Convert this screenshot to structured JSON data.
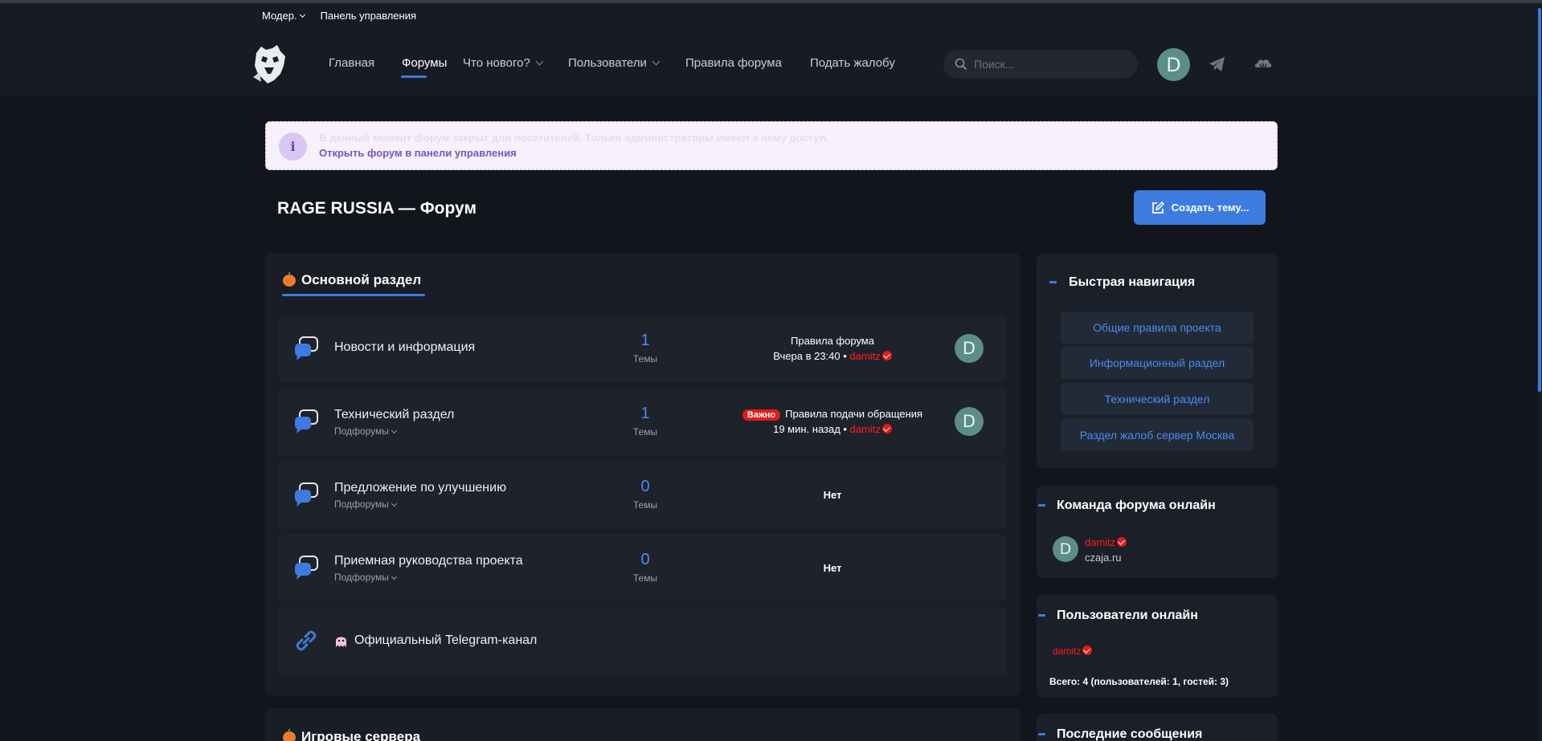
{
  "util_bar": {
    "moderation": "Модер.",
    "admin_panel": "Панель управления"
  },
  "nav": {
    "items": [
      {
        "label": "Главная"
      },
      {
        "label": "Форумы"
      },
      {
        "label": "Что нового?"
      },
      {
        "label": "Пользователи"
      },
      {
        "label": "Правила форума"
      },
      {
        "label": "Подать жалобу"
      }
    ],
    "active": "Форумы"
  },
  "search": {
    "placeholder": "Поиск..."
  },
  "header": {
    "avatar_letter": "D"
  },
  "notice": {
    "text": "В данный момент форум закрыт для посетителей. Только администраторы имеют к нему доступ.",
    "link": "Открыть форум в панели управления"
  },
  "page": {
    "title": "RAGE RUSSIA — Форум",
    "create_button": "Создать тему..."
  },
  "main_section": {
    "title": "Основной раздел",
    "forums": [
      {
        "title": "Новости и информация",
        "count": "1",
        "count_label": "Темы",
        "last_title": "Правила форума",
        "last_time": "Вчера в 23:40",
        "last_user": "damitz",
        "avatar": "D"
      },
      {
        "title": "Технический раздел",
        "subforums": "Подфорумы",
        "count": "1",
        "count_label": "Темы",
        "badge": "Важно",
        "last_title": "Правила подачи обращения",
        "last_time": "19 мин. назад",
        "last_user": "damitz",
        "avatar": "D"
      },
      {
        "title": "Предложение по улучшению",
        "subforums": "Подфорумы",
        "count": "0",
        "count_label": "Темы",
        "last_none": "Нет"
      },
      {
        "title": "Приемная руководства проекта",
        "subforums": "Подфорумы",
        "count": "0",
        "count_label": "Темы",
        "last_none": "Нет"
      },
      {
        "title": "Официальный Telegram-канал"
      }
    ]
  },
  "next_section": {
    "title": "Игровые сервера"
  },
  "sidebar": {
    "quick_nav": {
      "title": "Быстрая навигация",
      "links": [
        "Общие правила проекта",
        "Информационный раздел",
        "Технический раздел",
        "Раздел жалоб сервер Москва"
      ]
    },
    "staff_online": {
      "title": "Команда форума онлайн",
      "user": "damitz",
      "site": "czaja.ru",
      "avatar": "D"
    },
    "users_online": {
      "title": "Пользователи онлайн",
      "user": "damitz",
      "total": "Всего: 4 (пользователей: 1, гостей: 3)"
    },
    "latest_posts": {
      "title": "Последние сообщения"
    }
  },
  "colors": {
    "accent": "#3d7be0",
    "link": "#4a8cf0",
    "username_red": "#ff1d1d",
    "background": "#12151c"
  },
  "icons": [
    "search-icon",
    "telegram-icon",
    "cloud-icon",
    "edit-icon",
    "forum-chat-icon",
    "link-icon",
    "info-icon"
  ]
}
